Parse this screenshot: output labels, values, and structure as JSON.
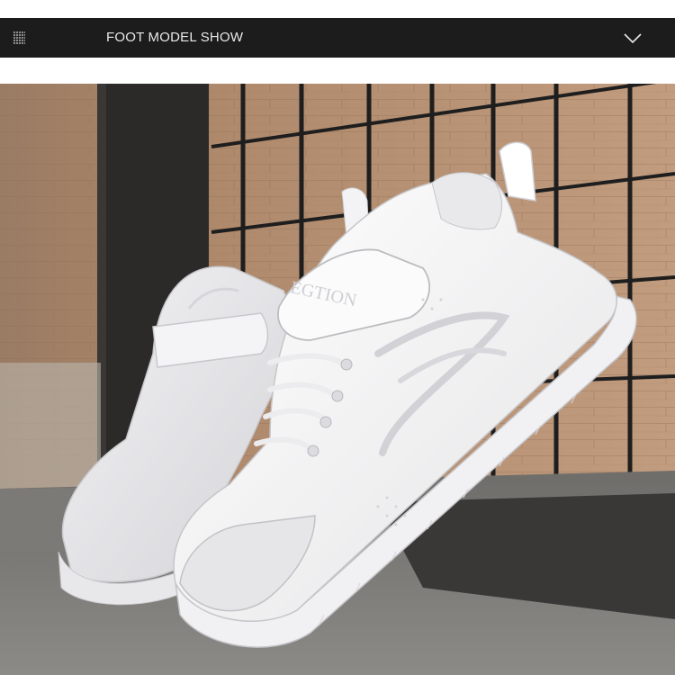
{
  "header": {
    "title": "FOOT MODEL SHOW",
    "menu_icon": "grid-pattern-icon",
    "toggle_icon": "chevron-down-icon",
    "background": "#1c1c1c",
    "text_color": "#e8e8e8"
  },
  "photo": {
    "subject": "white-sneakers-product-photo",
    "brand_print": "EGTION"
  }
}
